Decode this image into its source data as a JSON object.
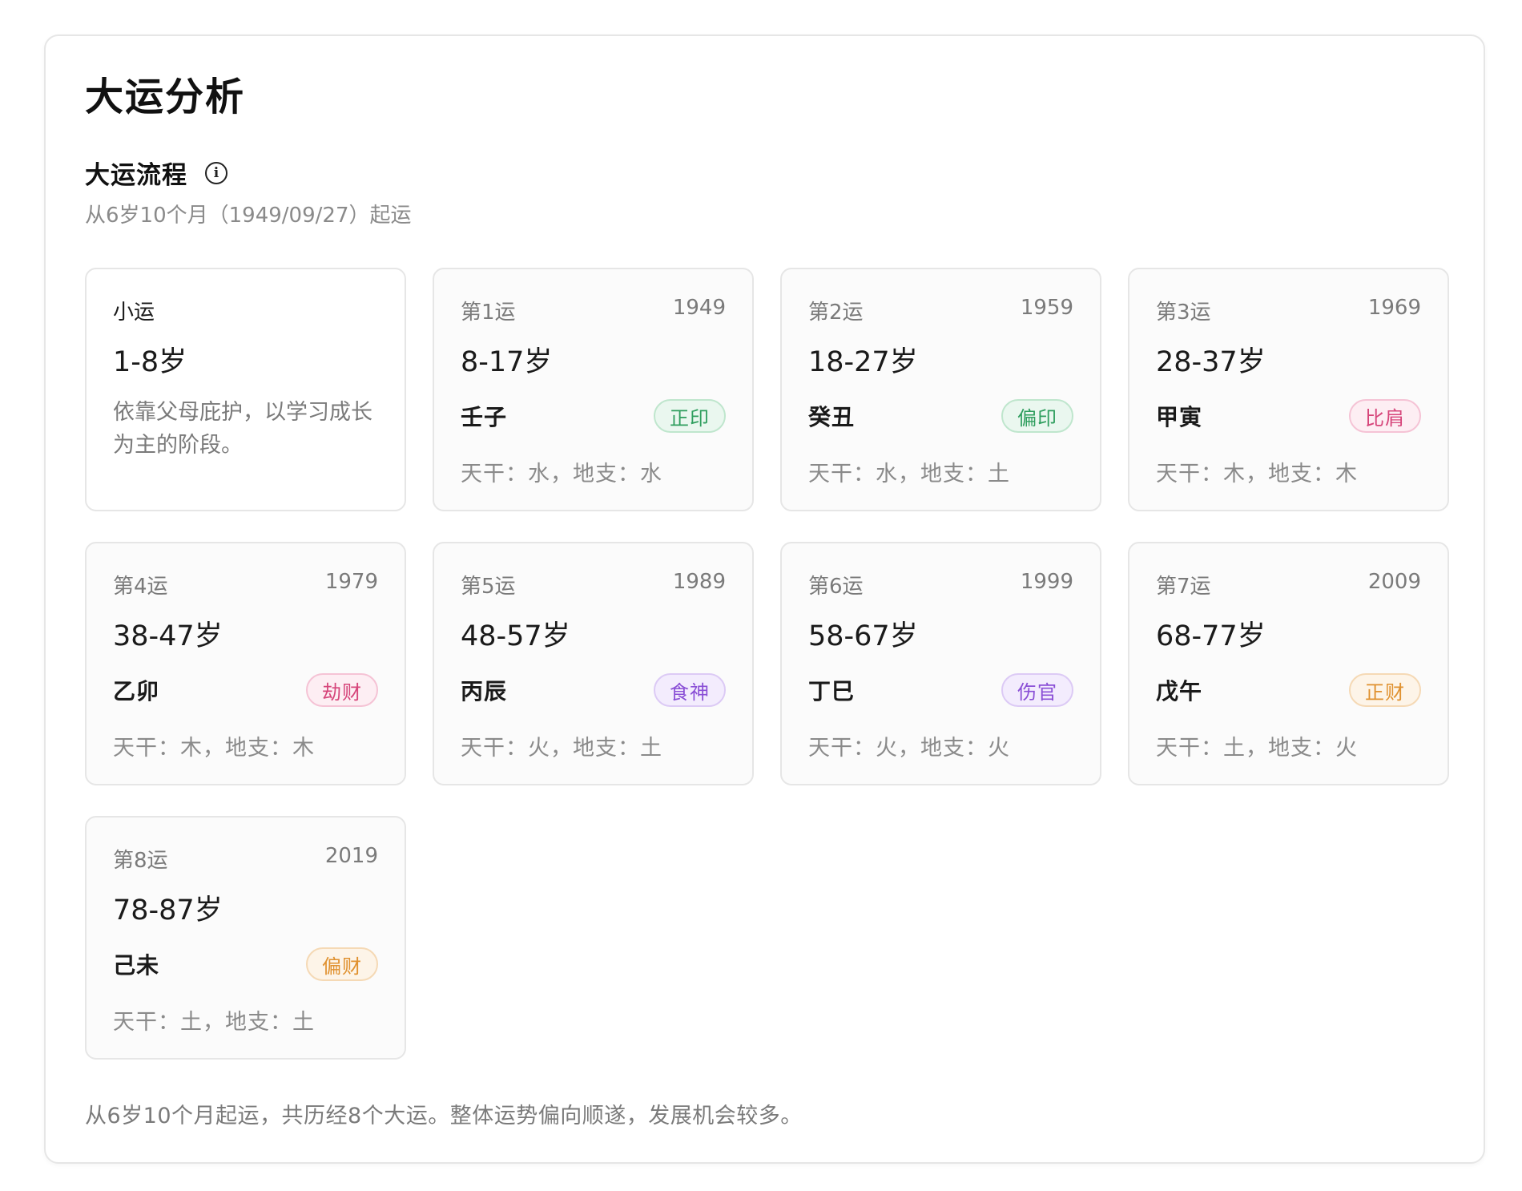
{
  "title": "大运分析",
  "section": {
    "title": "大运流程",
    "subtitle": "从6岁10个月（1949/09/27）起运"
  },
  "xiaoyun": {
    "label": "小运",
    "age": "1-8岁",
    "desc": "依靠父母庇护，以学习成长为主的阶段。"
  },
  "cards": [
    {
      "label": "第1运",
      "year": "1949",
      "age": "8-17岁",
      "ganzhi": "壬子",
      "tag": "正印",
      "tag_color": "#2f9e5e",
      "tag_bg": "#eaf7ef",
      "tag_border": "#bfe6cd",
      "wuxing": "天干：水，地支：水"
    },
    {
      "label": "第2运",
      "year": "1959",
      "age": "18-27岁",
      "ganzhi": "癸丑",
      "tag": "偏印",
      "tag_color": "#2f9e5e",
      "tag_bg": "#eaf7ef",
      "tag_border": "#bfe6cd",
      "wuxing": "天干：水，地支：土"
    },
    {
      "label": "第3运",
      "year": "1969",
      "age": "28-37岁",
      "ganzhi": "甲寅",
      "tag": "比肩",
      "tag_color": "#d6457a",
      "tag_bg": "#fdeef3",
      "tag_border": "#f5c3d5",
      "wuxing": "天干：木，地支：木"
    },
    {
      "label": "第4运",
      "year": "1979",
      "age": "38-47岁",
      "ganzhi": "乙卯",
      "tag": "劫财",
      "tag_color": "#d6457a",
      "tag_bg": "#fdeef3",
      "tag_border": "#f5c3d5",
      "wuxing": "天干：木，地支：木"
    },
    {
      "label": "第5运",
      "year": "1989",
      "age": "48-57岁",
      "ganzhi": "丙辰",
      "tag": "食神",
      "tag_color": "#8a4fd6",
      "tag_bg": "#f3ecfd",
      "tag_border": "#dccaf5",
      "wuxing": "天干：火，地支：土"
    },
    {
      "label": "第6运",
      "year": "1999",
      "age": "58-67岁",
      "ganzhi": "丁巳",
      "tag": "伤官",
      "tag_color": "#8a4fd6",
      "tag_bg": "#f3ecfd",
      "tag_border": "#dccaf5",
      "wuxing": "天干：火，地支：火"
    },
    {
      "label": "第7运",
      "year": "2009",
      "age": "68-77岁",
      "ganzhi": "戊午",
      "tag": "正财",
      "tag_color": "#e0912f",
      "tag_bg": "#fdf4e8",
      "tag_border": "#f5d9b5",
      "wuxing": "天干：土，地支：火"
    },
    {
      "label": "第8运",
      "year": "2019",
      "age": "78-87岁",
      "ganzhi": "己未",
      "tag": "偏财",
      "tag_color": "#e0912f",
      "tag_bg": "#fdf4e8",
      "tag_border": "#f5d9b5",
      "wuxing": "天干：土，地支：土"
    }
  ],
  "footer": "从6岁10个月起运，共历经8个大运。整体运势偏向顺遂，发展机会较多。",
  "icons": {
    "info": "info-circle-icon"
  }
}
